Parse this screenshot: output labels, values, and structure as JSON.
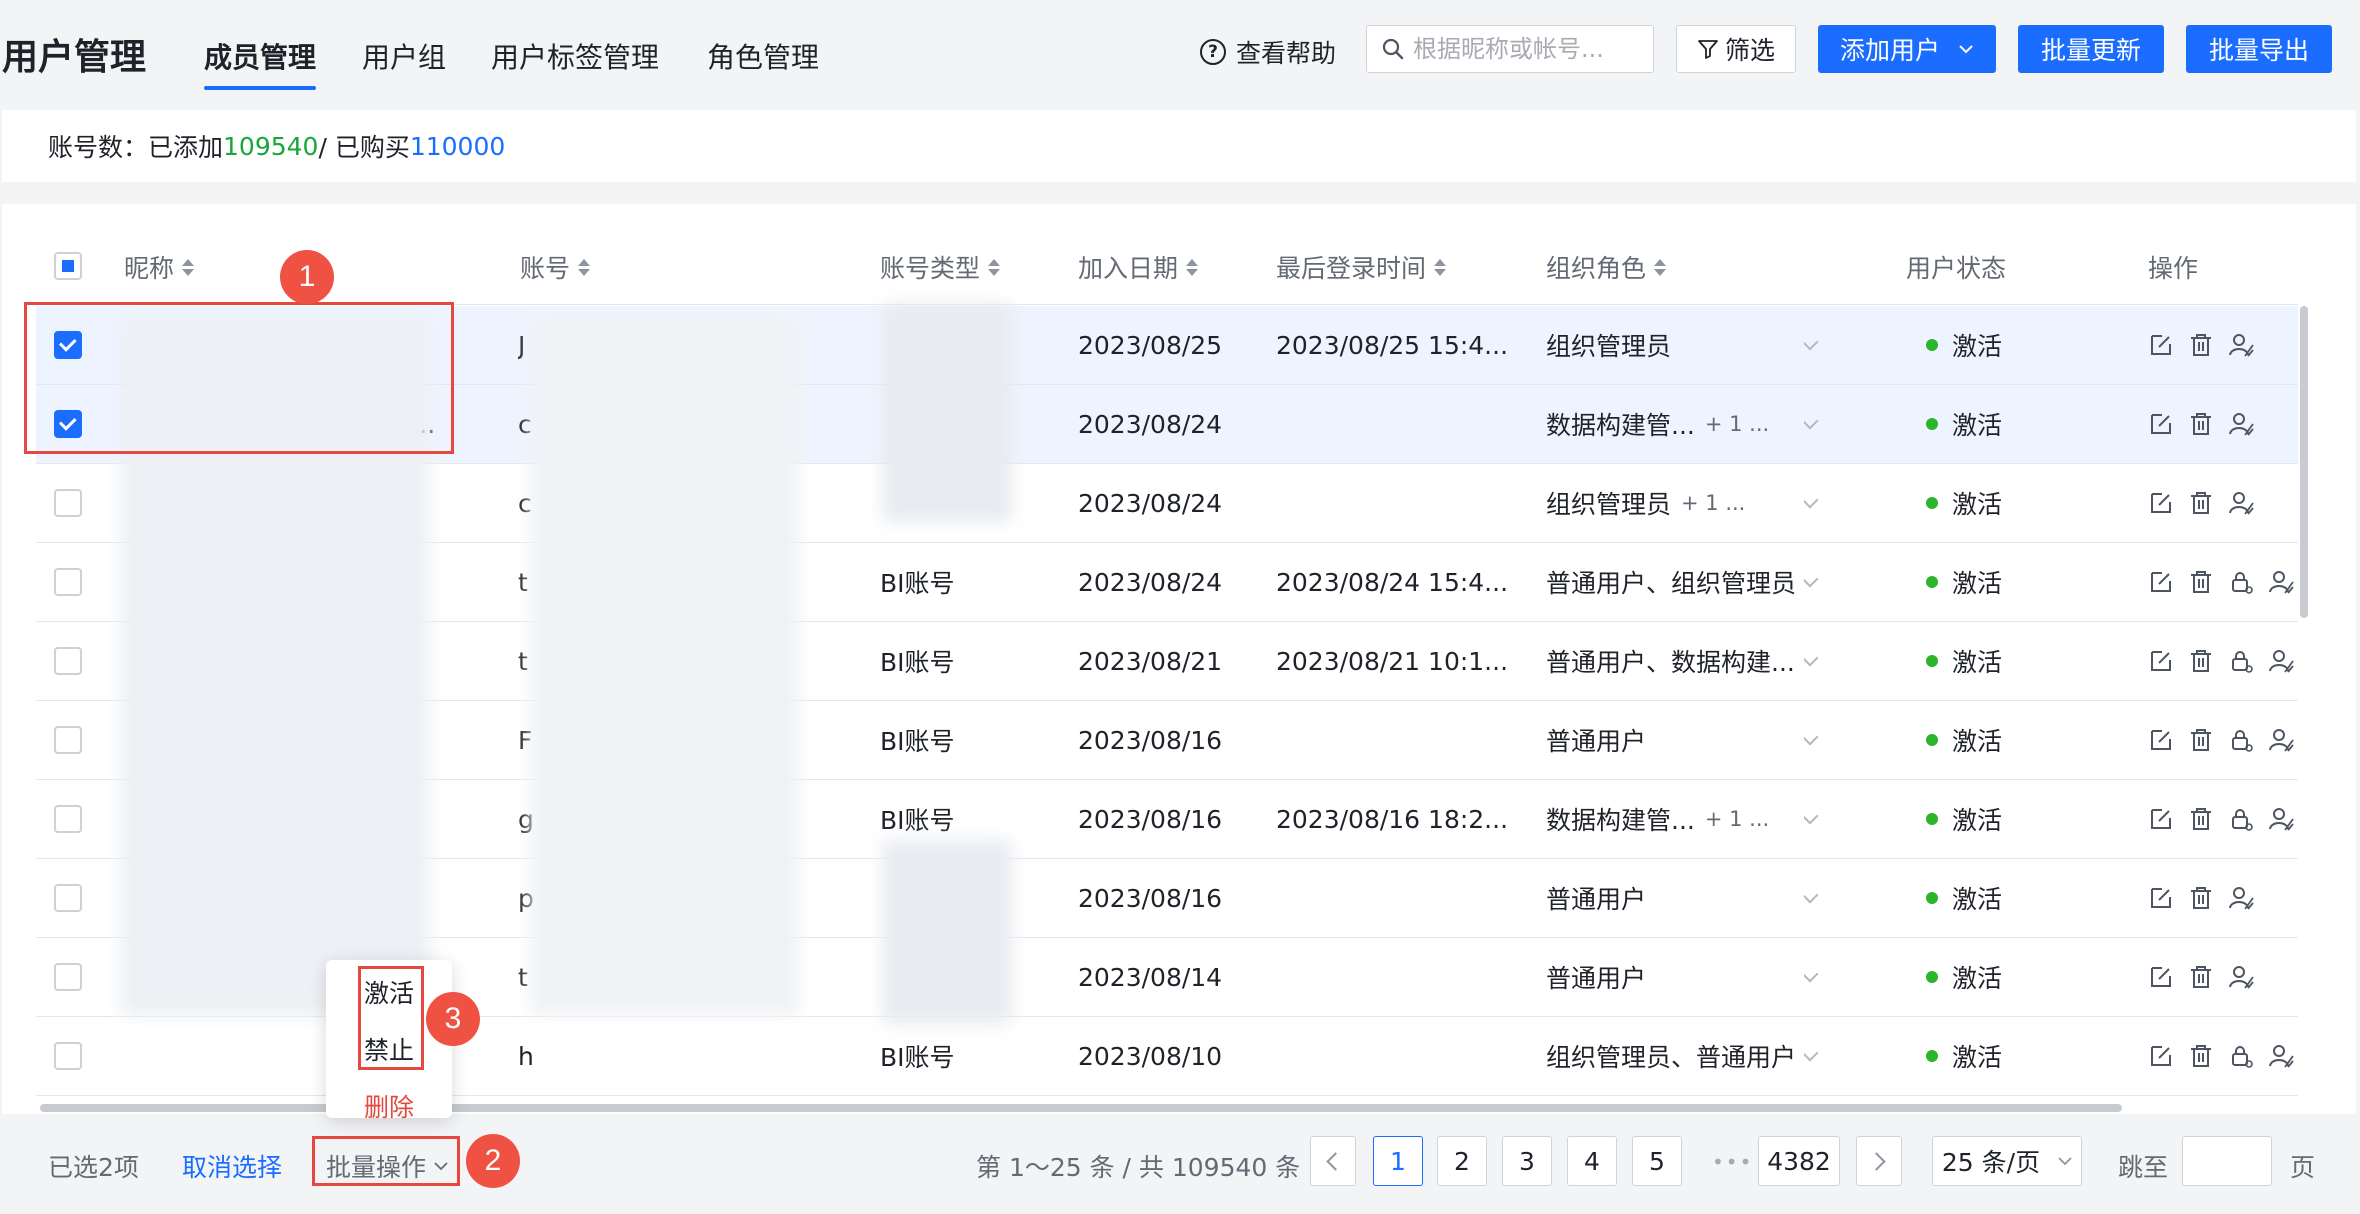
{
  "app": {
    "title": "用户管理"
  },
  "tabs": [
    {
      "label": "成员管理",
      "active": true
    },
    {
      "label": "用户组"
    },
    {
      "label": "用户标签管理"
    },
    {
      "label": "角色管理"
    }
  ],
  "toolbar": {
    "help_label": "查看帮助",
    "search_placeholder": "根据昵称或帐号...",
    "filter_label": "筛选",
    "add_user_label": "添加用户",
    "batch_update_label": "批量更新",
    "batch_export_label": "批量导出"
  },
  "account": {
    "prefix": "账号数：已添加 ",
    "added": "109540",
    "separator": " / 已购买 ",
    "purchased": "110000"
  },
  "table": {
    "headers": {
      "nickname": "昵称",
      "account": "账号",
      "account_type": "账号类型",
      "join_date": "加入日期",
      "last_login": "最后登录时间",
      "org_role": "组织角色",
      "status": "用户状态",
      "actions": "操作"
    },
    "rows": [
      {
        "checked": true,
        "nickname_tail": "",
        "account_head": "J",
        "type": "",
        "join": "2023/08/25",
        "login": "2023/08/25 15:4...",
        "role": "组织管理员",
        "role_more": "",
        "status": "激活",
        "lock": false
      },
      {
        "checked": true,
        "nickname_tail": "a...",
        "account_head": "c",
        "type": "",
        "join": "2023/08/24",
        "login": "",
        "role": "数据构建管...",
        "role_more": "+ 1 ...",
        "status": "激活",
        "lock": false
      },
      {
        "checked": false,
        "nickname_tail": "",
        "account_head": "c",
        "type": "",
        "join": "2023/08/24",
        "login": "",
        "role": "组织管理员",
        "role_more": "+ 1 ...",
        "status": "激活",
        "lock": false
      },
      {
        "checked": false,
        "nickname_tail": "",
        "account_head": "t",
        "type": "BI账号",
        "join": "2023/08/24",
        "login": "2023/08/24 15:4...",
        "role": "普通用户、组织管理员",
        "role_more": "",
        "status": "激活",
        "lock": true
      },
      {
        "checked": false,
        "nickname_tail": "",
        "account_head": "t",
        "type": "BI账号",
        "join": "2023/08/21",
        "login": "2023/08/21 10:1...",
        "role": "普通用户、数据构建...",
        "role_more": "",
        "status": "激活",
        "lock": true
      },
      {
        "checked": false,
        "nickname_tail": "",
        "account_head": "F",
        "type": "BI账号",
        "join": "2023/08/16",
        "login": "",
        "role": "普通用户",
        "role_more": "",
        "status": "激活",
        "lock": true
      },
      {
        "checked": false,
        "nickname_tail": "",
        "account_head": "g",
        "type": "BI账号",
        "join": "2023/08/16",
        "login": "2023/08/16 18:2...",
        "role": "数据构建管...",
        "role_more": "+ 1 ...",
        "status": "激活",
        "lock": true
      },
      {
        "checked": false,
        "nickname_tail": "",
        "account_head": "p",
        "type": "",
        "join": "2023/08/16",
        "login": "",
        "role": "普通用户",
        "role_more": "",
        "status": "激活",
        "lock": false
      },
      {
        "checked": false,
        "nickname_tail": "",
        "account_head": "t",
        "type": "",
        "join": "2023/08/14",
        "login": "",
        "role": "普通用户",
        "role_more": "",
        "status": "激活",
        "lock": false
      },
      {
        "checked": false,
        "nickname_tail": "",
        "account_head": "h",
        "type": "BI账号",
        "join": "2023/08/10",
        "login": "",
        "role": "组织管理员、普通用户",
        "role_more": "",
        "status": "激活",
        "lock": true
      }
    ]
  },
  "footer": {
    "selected": "已选2项",
    "cancel": "取消选择",
    "batch_ops": "批量操作",
    "range": "第 1～25 条 / 共 109540 条",
    "pages": [
      "1",
      "2",
      "3",
      "4",
      "5"
    ],
    "ellipsis": "•••",
    "last_page": "4382",
    "page_size": "25 条/页",
    "jump_label": "跳至",
    "page_unit": "页"
  },
  "dropdown": {
    "items": [
      {
        "label": "激活"
      },
      {
        "label": "禁止"
      },
      {
        "label": "删除",
        "danger": true
      }
    ]
  },
  "annotations": {
    "badge1": "1",
    "badge2": "2",
    "badge3": "3"
  },
  "colors": {
    "accent": "#1a6dff",
    "added_green": "#19a73a",
    "status_green": "#2bb52b",
    "annotation_red": "#e5483f"
  }
}
